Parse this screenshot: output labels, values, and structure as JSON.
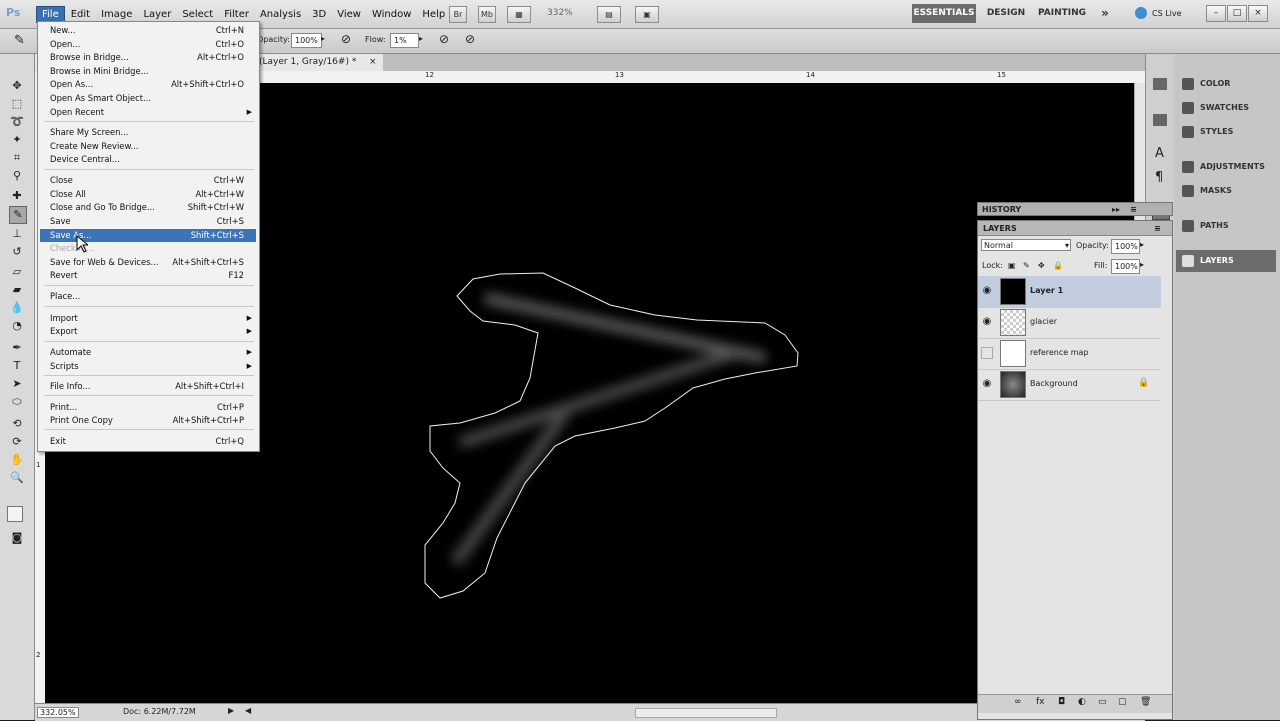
{
  "app": {
    "logo": "Ps"
  },
  "menubar": {
    "items": [
      "File",
      "Edit",
      "Image",
      "Layer",
      "Select",
      "Filter",
      "Analysis",
      "3D",
      "View",
      "Window",
      "Help"
    ],
    "bridge": "Br",
    "minibridge": "Mb",
    "zoom": "332%",
    "workspaces": [
      "ESSENTIALS",
      "DESIGN",
      "PAINTING"
    ],
    "more": "»",
    "cslive": "CS Live",
    "win_controls": [
      "–",
      "□",
      "×"
    ]
  },
  "options": {
    "opacity_label": "Opacity:",
    "opacity_value": "100%",
    "flow_label": "Flow:",
    "flow_value": "1%"
  },
  "document": {
    "tab_title": "(Layer 1, Gray/16#) *",
    "ruler_marks": [
      "12",
      "13",
      "14",
      "15"
    ],
    "left_ruler_marks": [
      "1",
      "2"
    ]
  },
  "status": {
    "zoom": "332.05%",
    "doc": "Doc: 6.22M/7.72M"
  },
  "file_menu": {
    "items": [
      {
        "label": "New...",
        "shortcut": "Ctrl+N"
      },
      {
        "label": "Open...",
        "shortcut": "Ctrl+O"
      },
      {
        "label": "Browse in Bridge...",
        "shortcut": "Alt+Ctrl+O"
      },
      {
        "label": "Browse in Mini Bridge...",
        "shortcut": ""
      },
      {
        "label": "Open As...",
        "shortcut": "Alt+Shift+Ctrl+O"
      },
      {
        "label": "Open As Smart Object...",
        "shortcut": ""
      },
      {
        "label": "Open Recent",
        "shortcut": ""
      },
      {
        "label": "Share My Screen...",
        "shortcut": ""
      },
      {
        "label": "Create New Review...",
        "shortcut": ""
      },
      {
        "label": "Device Central...",
        "shortcut": ""
      },
      {
        "label": "Close",
        "shortcut": "Ctrl+W"
      },
      {
        "label": "Close All",
        "shortcut": "Alt+Ctrl+W"
      },
      {
        "label": "Close and Go To Bridge...",
        "shortcut": "Shift+Ctrl+W"
      },
      {
        "label": "Save",
        "shortcut": "Ctrl+S"
      },
      {
        "label": "Save As...",
        "shortcut": "Shift+Ctrl+S"
      },
      {
        "label": "Check In...",
        "shortcut": ""
      },
      {
        "label": "Save for Web & Devices...",
        "shortcut": "Alt+Shift+Ctrl+S"
      },
      {
        "label": "Revert",
        "shortcut": "F12"
      },
      {
        "label": "Place...",
        "shortcut": ""
      },
      {
        "label": "Import",
        "shortcut": ""
      },
      {
        "label": "Export",
        "shortcut": ""
      },
      {
        "label": "Automate",
        "shortcut": ""
      },
      {
        "label": "Scripts",
        "shortcut": ""
      },
      {
        "label": "File Info...",
        "shortcut": "Alt+Shift+Ctrl+I"
      },
      {
        "label": "Print...",
        "shortcut": "Ctrl+P"
      },
      {
        "label": "Print One Copy",
        "shortcut": "Alt+Shift+Ctrl+P"
      },
      {
        "label": "Exit",
        "shortcut": "Ctrl+Q"
      }
    ]
  },
  "dock": {
    "items": [
      "COLOR",
      "SWATCHES",
      "STYLES",
      "ADJUSTMENTS",
      "MASKS",
      "PATHS",
      "LAYERS"
    ]
  },
  "history": {
    "title": "HISTORY"
  },
  "layers": {
    "title": "LAYERS",
    "blend_mode": "Normal",
    "opacity_label": "Opacity:",
    "opacity_value": "100%",
    "lock_label": "Lock:",
    "fill_label": "Fill:",
    "fill_value": "100%",
    "rows": [
      {
        "name": "Layer 1",
        "visible": true
      },
      {
        "name": "glacier",
        "visible": true
      },
      {
        "name": "reference map",
        "visible": false
      },
      {
        "name": "Background",
        "visible": true
      }
    ]
  }
}
